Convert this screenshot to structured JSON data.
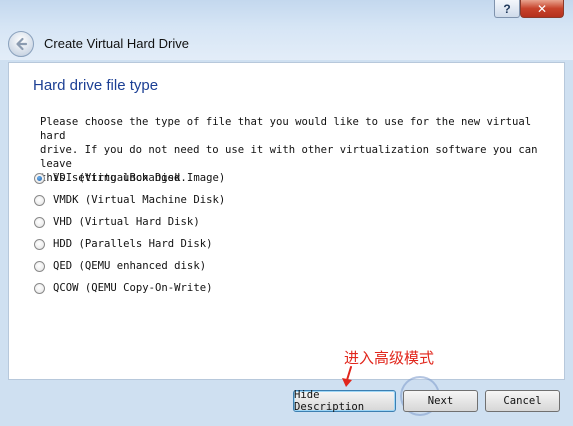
{
  "window": {
    "title": "Create Virtual Hard Drive",
    "help_glyph": "?",
    "close_glyph": "✕",
    "icons": {
      "back": "back-arrow-icon",
      "arrow": "red-arrow-icon"
    }
  },
  "page": {
    "heading": "Hard drive file type",
    "description_lines": [
      "Please choose the type of file that you would like to use for the new virtual hard",
      "drive. If you do not need to use it with other virtualization software you can leave",
      "this setting unchanged."
    ]
  },
  "options": [
    {
      "label": "VDI (VirtualBox Disk Image)",
      "checked": true
    },
    {
      "label": "VMDK (Virtual Machine Disk)",
      "checked": false
    },
    {
      "label": "VHD (Virtual Hard Disk)",
      "checked": false
    },
    {
      "label": "HDD (Parallels Hard Disk)",
      "checked": false
    },
    {
      "label": "QED (QEMU enhanced disk)",
      "checked": false
    },
    {
      "label": "QCOW (QEMU Copy-On-Write)",
      "checked": false
    }
  ],
  "annotation": {
    "text": "进入高级模式",
    "color": "#e1261c"
  },
  "buttons": {
    "hide_description": "Hide Description",
    "next": "Next",
    "cancel": "Cancel"
  },
  "colors": {
    "heading": "#1c3f94",
    "frame": "#cfe0f1",
    "focus_border": "#3c7fb1"
  }
}
